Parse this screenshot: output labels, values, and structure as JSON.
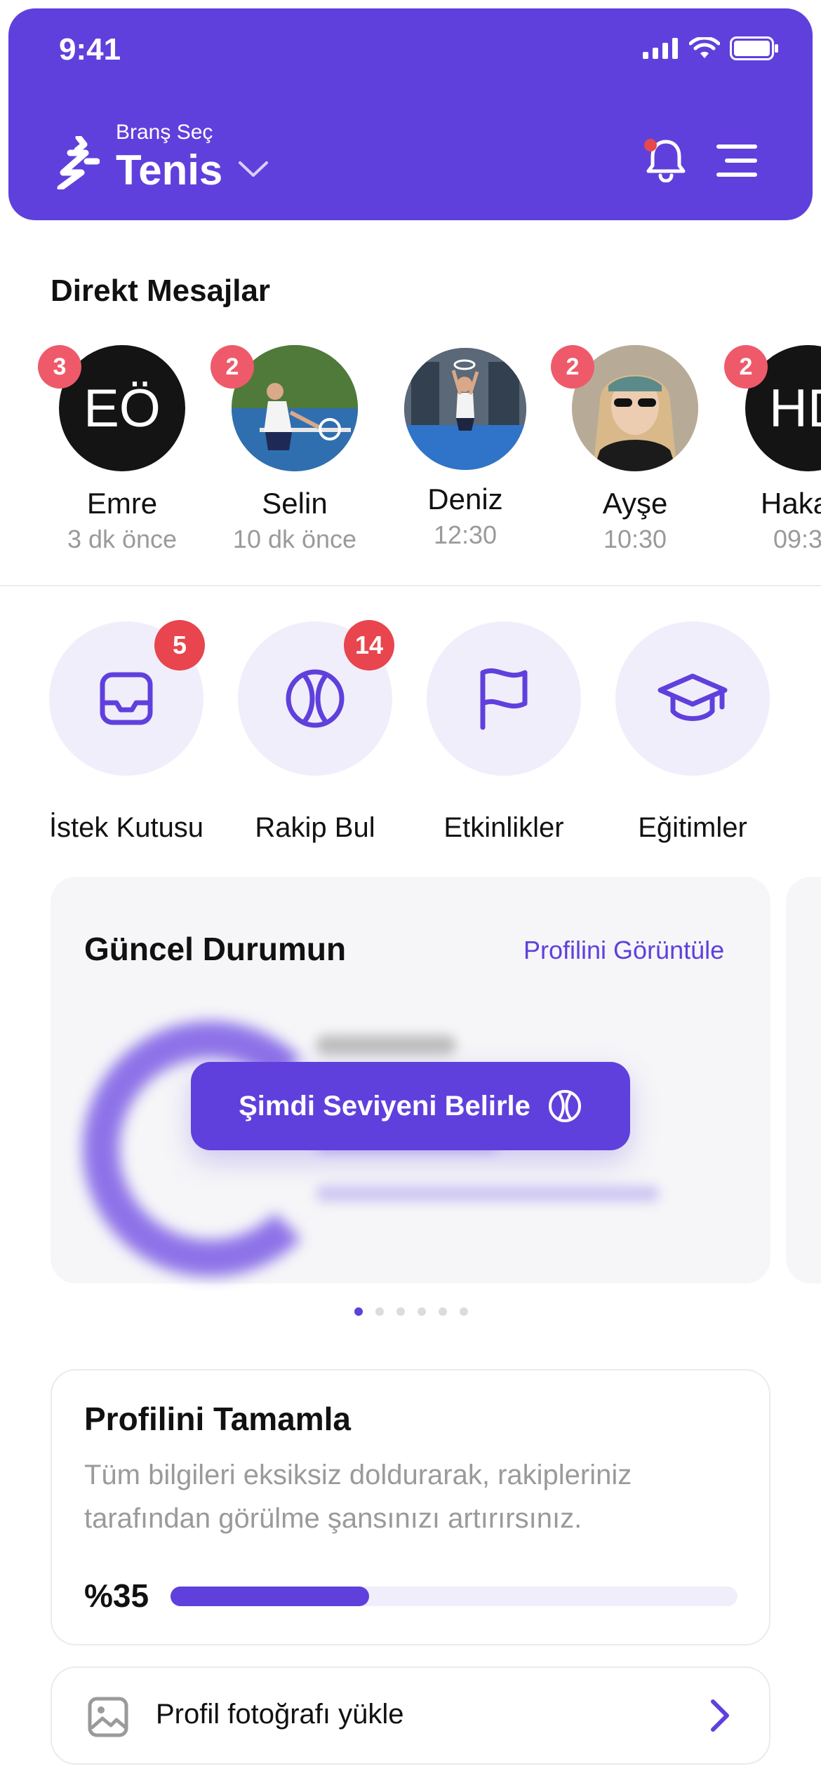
{
  "status_bar": {
    "time": "9:41"
  },
  "header": {
    "branch_label": "Branş Seç",
    "branch_value": "Tenis"
  },
  "direct_messages": {
    "title": "Direkt Mesajlar",
    "items": [
      {
        "name": "Emre",
        "time": "3 dk önce",
        "badge": "3",
        "initials": "EÖ"
      },
      {
        "name": "Selin",
        "time": "10 dk önce",
        "badge": "2"
      },
      {
        "name": "Deniz",
        "time": "12:30",
        "badge": ""
      },
      {
        "name": "Ayşe",
        "time": "10:30",
        "badge": "2"
      },
      {
        "name": "Hakan",
        "time": "09:3",
        "badge": "2",
        "initials": "HD"
      }
    ]
  },
  "quick_actions": [
    {
      "label": "İstek Kutusu",
      "badge": "5",
      "icon": "inbox-icon"
    },
    {
      "label": "Rakip Bul",
      "badge": "14",
      "icon": "tennis-ball-icon"
    },
    {
      "label": "Etkinlikler",
      "badge": "",
      "icon": "flag-icon"
    },
    {
      "label": "Eğitimler",
      "badge": "",
      "icon": "graduation-cap-icon"
    }
  ],
  "status_card": {
    "title": "Güncel Durumun",
    "link": "Profilini Görüntüle",
    "cta": "Şimdi Seviyeni Belirle",
    "pager_count": 6,
    "pager_active": 0
  },
  "profile_completion": {
    "title": "Profilini Tamamla",
    "description": "Tüm bilgileri eksiksiz doldurarak, rakipleriniz tarafından görülme şansınızı artırırsınız.",
    "percent_label": "%35",
    "progress": 0.35
  },
  "profile_photo": {
    "label": "Profil fotoğrafı yükle"
  },
  "colors": {
    "accent": "#6040DC",
    "badge": "#EE5A6A",
    "soft": "#F1EEFB"
  }
}
